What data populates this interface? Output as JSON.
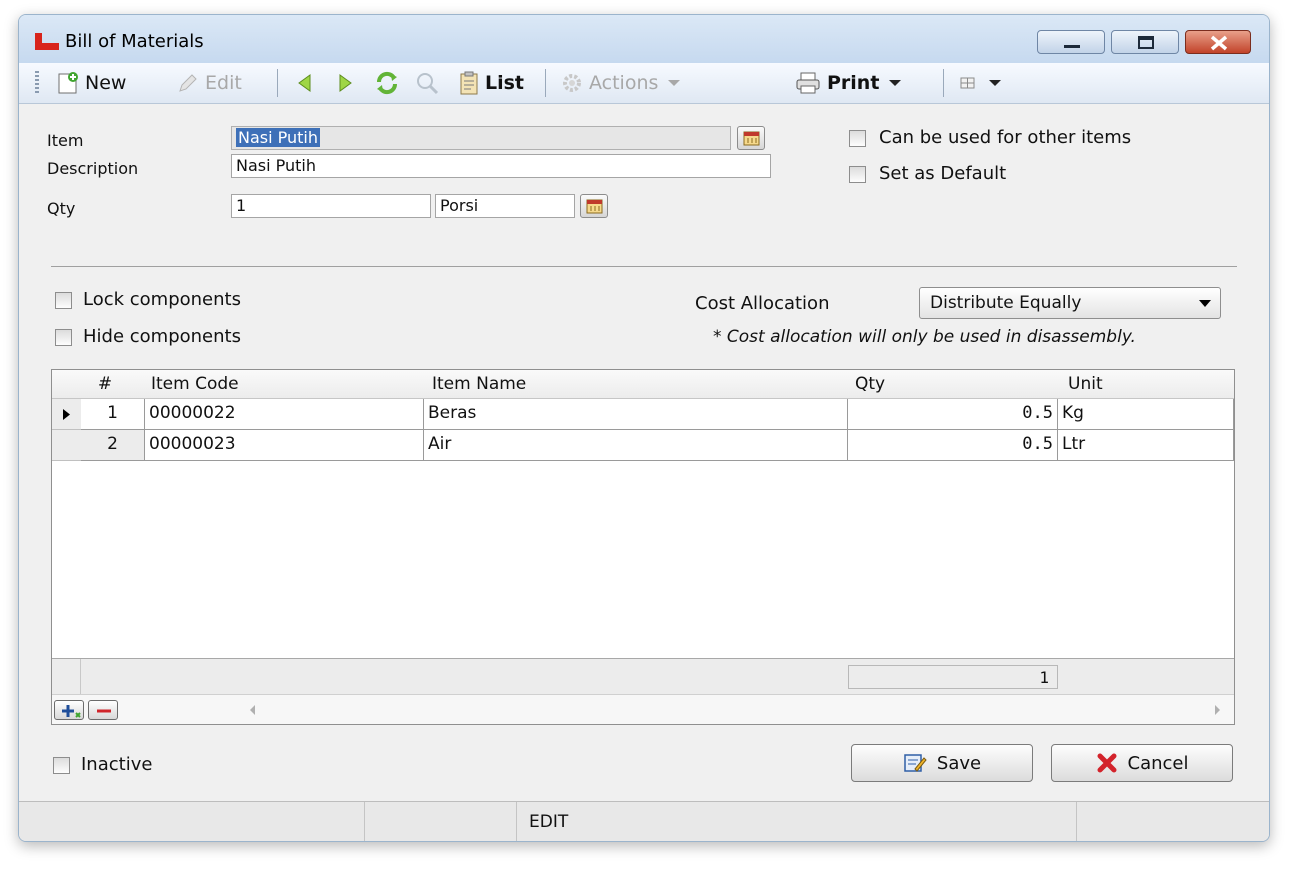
{
  "window": {
    "title": "Bill of Materials"
  },
  "toolbar": {
    "new": "New",
    "edit": "Edit",
    "list": "List",
    "actions": "Actions",
    "print": "Print"
  },
  "form": {
    "item_label": "Item",
    "item_value": "Nasi Putih",
    "description_label": "Description",
    "description_value": "Nasi Putih",
    "qty_label": "Qty",
    "qty_value": "1",
    "unit_value": "Porsi",
    "can_be_used_label": "Can be used for other items",
    "set_default_label": "Set as Default",
    "lock_components_label": "Lock components",
    "hide_components_label": "Hide components",
    "cost_allocation_label": "Cost Allocation",
    "cost_allocation_value": "Distribute Equally",
    "cost_note": "* Cost allocation will only be used in disassembly."
  },
  "grid": {
    "columns": [
      "#",
      "Item Code",
      "Item Name",
      "Qty",
      "Unit"
    ],
    "rows": [
      {
        "no": "1",
        "code": "00000022",
        "name": "Beras",
        "qty": "0.5",
        "unit": "Kg",
        "current": true
      },
      {
        "no": "2",
        "code": "00000023",
        "name": "Air",
        "qty": "0.5",
        "unit": "Ltr",
        "current": false
      }
    ],
    "footer_count": "1"
  },
  "bottom": {
    "inactive_label": "Inactive",
    "save": "Save",
    "cancel": "Cancel"
  },
  "status": {
    "mode": "EDIT"
  }
}
